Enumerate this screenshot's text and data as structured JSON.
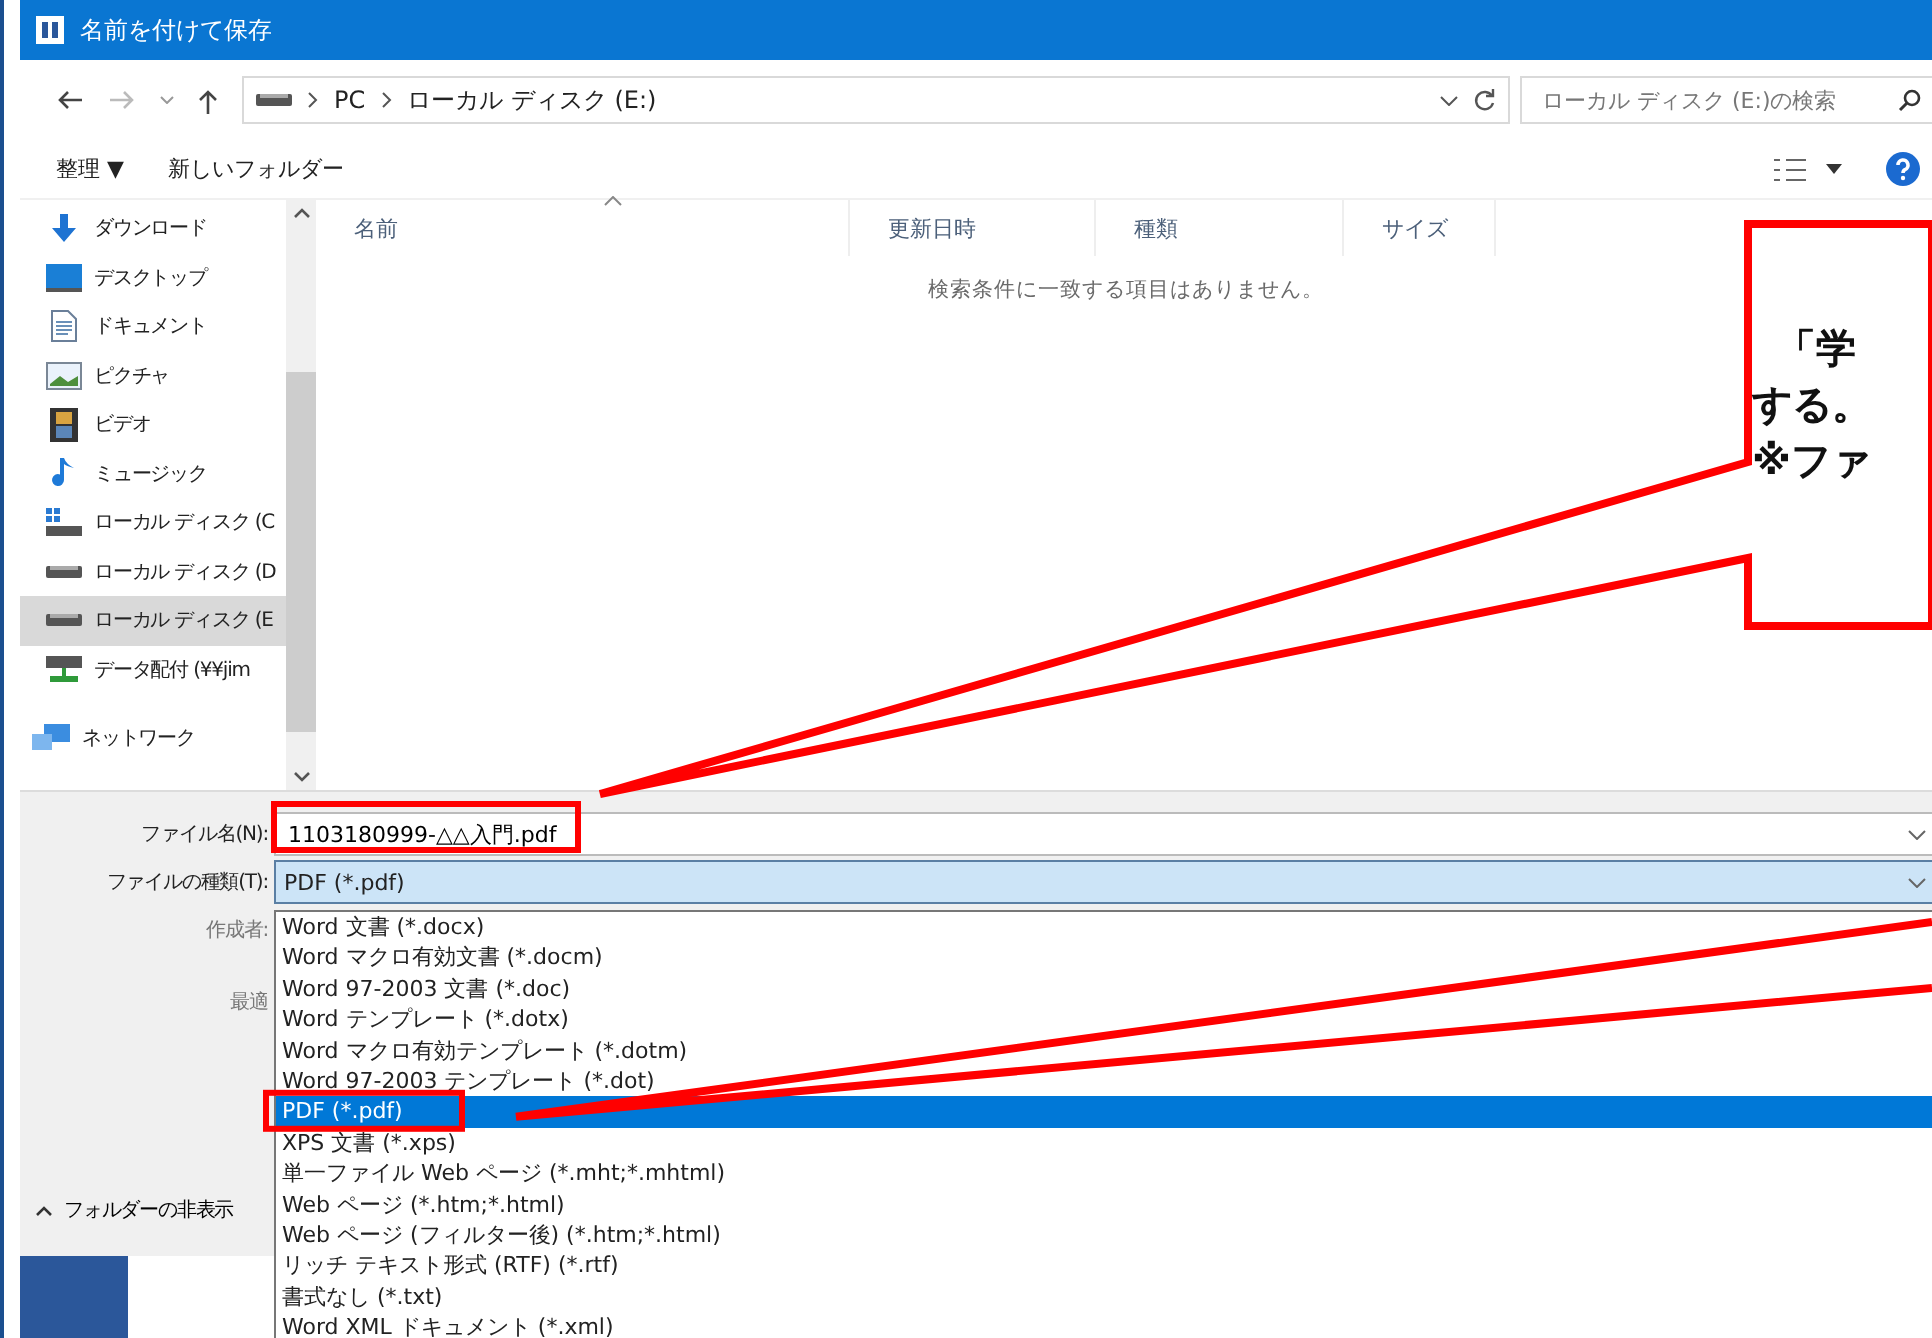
{
  "window": {
    "title": "名前を付けて保存"
  },
  "address": {
    "crumbs": [
      "PC",
      "ローカル ディスク (E:)"
    ],
    "search_placeholder": "ローカル ディスク (E:)の検索"
  },
  "toolbar": {
    "organize": "整理 ▼",
    "new_folder": "新しいフォルダー"
  },
  "nav": {
    "pc_items": [
      {
        "label": "ダウンロード",
        "kind": "download",
        "selected": false
      },
      {
        "label": "デスクトップ",
        "kind": "desktop",
        "selected": false
      },
      {
        "label": "ドキュメント",
        "kind": "documents",
        "selected": false
      },
      {
        "label": "ピクチャ",
        "kind": "pictures",
        "selected": false
      },
      {
        "label": "ビデオ",
        "kind": "video",
        "selected": false
      },
      {
        "label": "ミュージック",
        "kind": "music",
        "selected": false
      },
      {
        "label": "ローカル ディスク (C",
        "kind": "system-drive",
        "selected": false
      },
      {
        "label": "ローカル ディスク (D",
        "kind": "drive",
        "selected": false
      },
      {
        "label": "ローカル ディスク (E",
        "kind": "drive",
        "selected": true
      },
      {
        "label": "データ配付 (¥¥jim",
        "kind": "network-drive",
        "selected": false
      }
    ],
    "roots": [
      {
        "label": "ネットワーク",
        "kind": "network",
        "selected": false
      }
    ]
  },
  "table": {
    "columns": [
      "名前",
      "更新日時",
      "種類",
      "サイズ"
    ],
    "empty_message": "検索条件に一致する項目はありません。"
  },
  "form": {
    "file_name_label": "ファイル名(N):",
    "file_name": "1103180999-△△入門.pdf",
    "file_type_label": "ファイルの種類(T):",
    "file_type": "PDF (*.pdf)",
    "author_label": "作成者:",
    "optimize_label": "最適",
    "hide_folders": "フォルダーの非表示"
  },
  "file_type_options": [
    {
      "label": "Word 文書 (*.docx)",
      "selected": false
    },
    {
      "label": "Word マクロ有効文書 (*.docm)",
      "selected": false
    },
    {
      "label": "Word 97-2003 文書 (*.doc)",
      "selected": false
    },
    {
      "label": "Word テンプレート (*.dotx)",
      "selected": false
    },
    {
      "label": "Word マクロ有効テンプレート (*.dotm)",
      "selected": false
    },
    {
      "label": "Word 97-2003 テンプレート (*.dot)",
      "selected": false
    },
    {
      "label": "PDF (*.pdf)",
      "selected": true
    },
    {
      "label": "XPS 文書 (*.xps)",
      "selected": false
    },
    {
      "label": "単一ファイル Web ページ (*.mht;*.mhtml)",
      "selected": false
    },
    {
      "label": "Web ページ (*.htm;*.html)",
      "selected": false
    },
    {
      "label": "Web ページ (フィルター後) (*.htm;*.html)",
      "selected": false
    },
    {
      "label": "リッチ テキスト形式 (RTF) (*.rtf)",
      "selected": false
    },
    {
      "label": "書式なし (*.txt)",
      "selected": false
    },
    {
      "label": "Word XML ドキュメント (*.xml)",
      "selected": false
    }
  ],
  "callout": {
    "lines": [
      "「学",
      "する。",
      "※ファ"
    ]
  }
}
